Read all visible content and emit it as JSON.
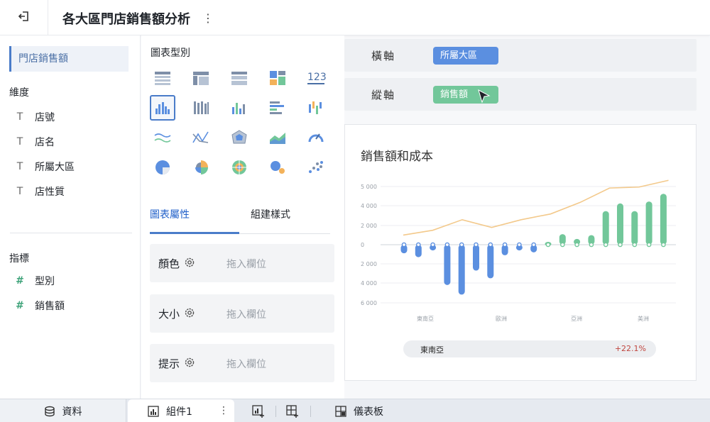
{
  "header": {
    "title": "各大區門店銷售額分析",
    "back_icon": "exit-icon",
    "more_label": "⋮"
  },
  "left": {
    "dataset_name": "門店銷售額",
    "dimensions_title": "維度",
    "dimensions": [
      {
        "icon": "T",
        "label": "店號"
      },
      {
        "icon": "T",
        "label": "店名"
      },
      {
        "icon": "T",
        "label": "所屬大區"
      },
      {
        "icon": "T",
        "label": "店性質"
      }
    ],
    "measures_title": "指標",
    "measures": [
      {
        "icon": "#",
        "label": "型別"
      },
      {
        "icon": "#",
        "label": "銷售額"
      }
    ]
  },
  "middle": {
    "chart_type_title": "圖表型別",
    "chart_types": [
      "table",
      "cross-table",
      "detail-table",
      "kpi-blocks",
      "number-123",
      "grouped-column",
      "stacked-column",
      "column",
      "bar",
      "range-column",
      "line",
      "radar-line",
      "radar",
      "area",
      "gauge",
      "pie",
      "rose",
      "sunburst",
      "bubble",
      "scatter"
    ],
    "selected_chart_type": "grouped-column",
    "tab_properties": "圖表屬性",
    "tab_styles": "組建樣式",
    "properties": [
      {
        "label": "顏色",
        "placeholder": "拖入欄位"
      },
      {
        "label": "大小",
        "placeholder": "拖入欄位"
      },
      {
        "label": "提示",
        "placeholder": "拖入欄位"
      }
    ]
  },
  "axes": {
    "x_label": "橫軸",
    "x_field": "所屬大區",
    "x_color": "#5b8fe0",
    "y_label": "縱軸",
    "y_field": "銷售額",
    "y_color": "#72c79a"
  },
  "chart_data": {
    "type": "bar",
    "title": "銷售額和成本",
    "yticks": [
      "5 000",
      "4 000",
      "2 000",
      "0",
      "2 000",
      "4 000",
      "6 000"
    ],
    "ylim": [
      -6000,
      6000
    ],
    "categories": [
      "東南亞",
      "歐洲",
      "亞洲",
      "美洲"
    ],
    "series": [
      {
        "values": [
          -900,
          -1300,
          -600,
          -4200,
          -5200,
          -2700,
          -3500,
          -1100,
          -600,
          -800,
          300,
          1100,
          600,
          1000,
          3500,
          4300,
          3500,
          4500,
          5300
        ]
      },
      {
        "values": [
          1000,
          1500,
          2600,
          1800,
          2600,
          3200,
          4400,
          5900,
          6000,
          6700
        ]
      }
    ],
    "tooltip_category": "東南亞",
    "tooltip_value": "+22.1%"
  },
  "colors": {
    "negative_bar": "#5b8fe0",
    "positive_bar": "#72c79a",
    "line": "#f3c98b",
    "accent": "#4a7cc9"
  },
  "bottom": {
    "data_tab": "資料",
    "component_tab": "組件1",
    "dashboard_tab": "儀表板"
  }
}
